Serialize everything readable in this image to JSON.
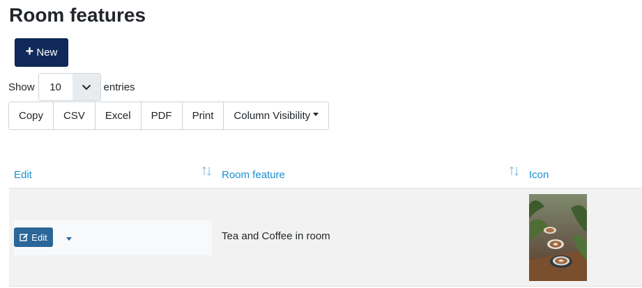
{
  "page": {
    "title": "Room features"
  },
  "toolbar": {
    "new_label": "New"
  },
  "length_control": {
    "show_label": "Show",
    "value": "10",
    "entries_label": "entries"
  },
  "export_buttons": [
    "Copy",
    "CSV",
    "Excel",
    "PDF",
    "Print",
    "Column Visibility"
  ],
  "table": {
    "columns": [
      "Edit",
      "Room feature",
      "Icon"
    ],
    "rows": [
      {
        "edit_label": "Edit",
        "feature": "Tea and Coffee in room",
        "icon": "coffee-cups-photo"
      }
    ]
  },
  "colors": {
    "new_button": "#0f2a5a",
    "edit_button": "#2b6698",
    "link": "#1a8fd1"
  }
}
